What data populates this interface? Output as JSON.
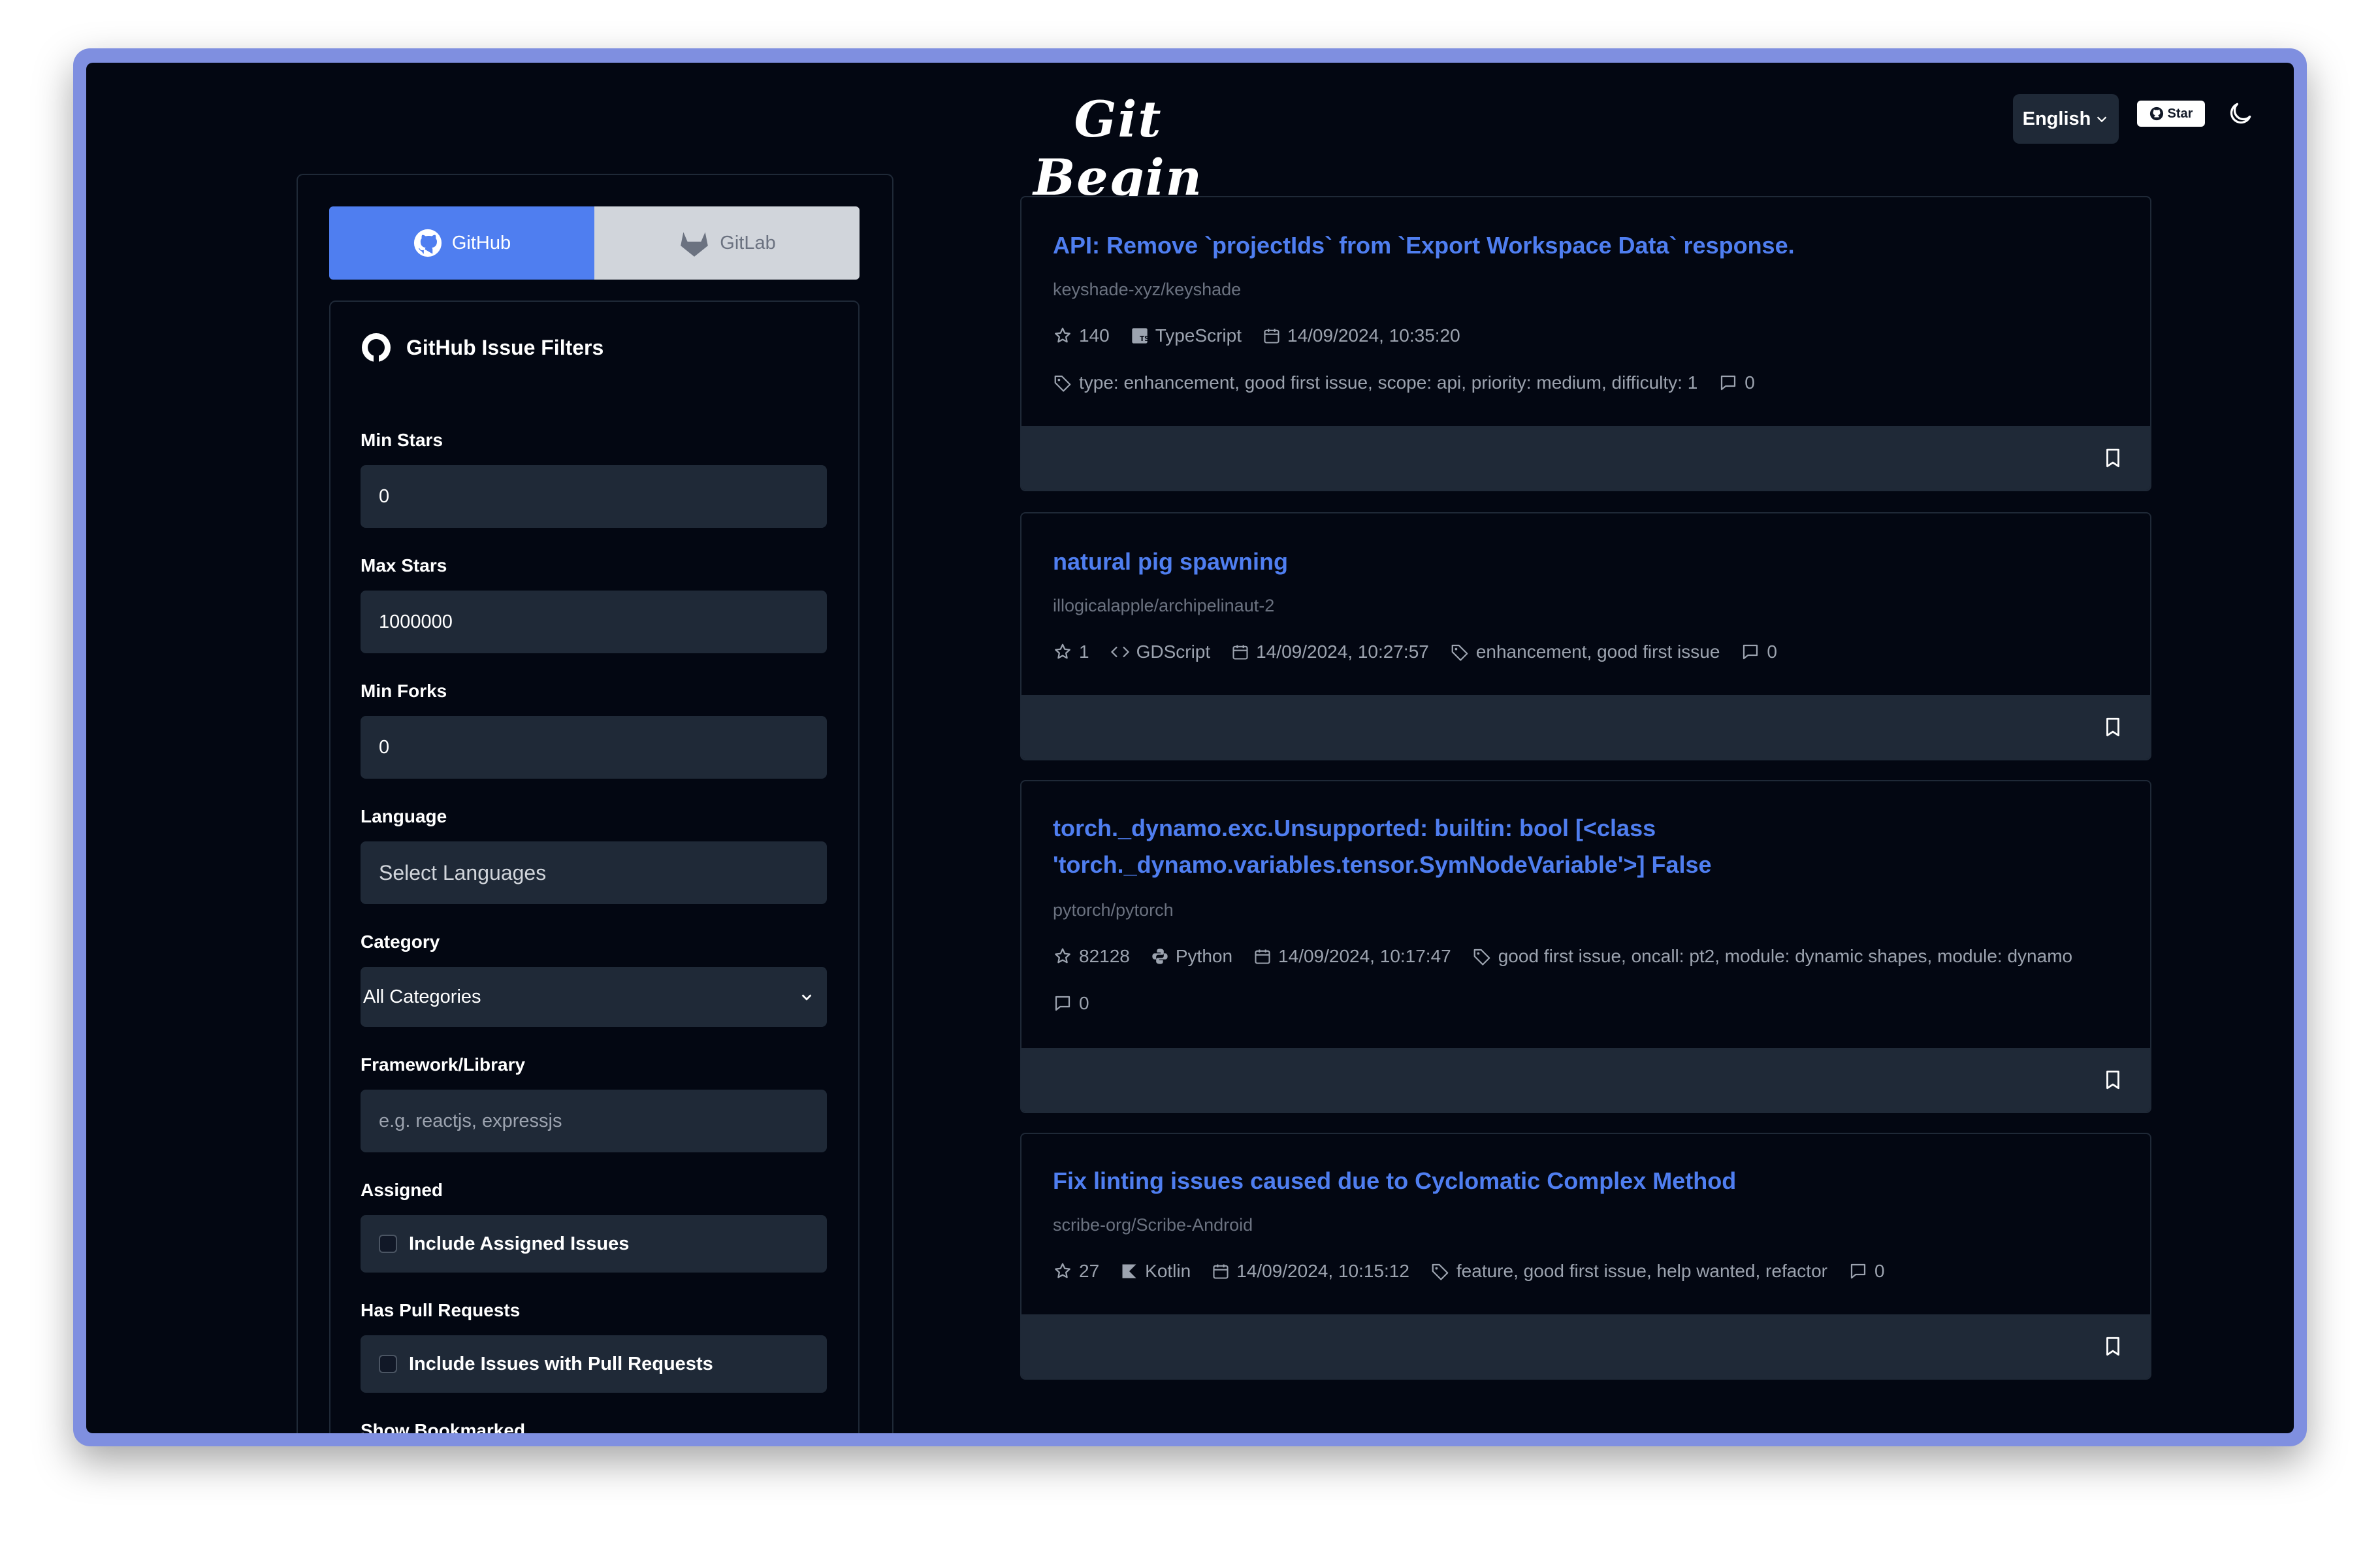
{
  "header": {
    "logo_text": "Git Begin",
    "language_label": "English",
    "star_label": "Star"
  },
  "tabs": [
    {
      "label": "GitHub",
      "icon": "github-icon",
      "active": true
    },
    {
      "label": "GitLab",
      "icon": "gitlab-icon",
      "active": false
    }
  ],
  "filters": {
    "title": "GitHub Issue Filters",
    "min_stars_label": "Min Stars",
    "min_stars_value": "0",
    "max_stars_label": "Max Stars",
    "max_stars_value": "1000000",
    "min_forks_label": "Min Forks",
    "min_forks_value": "0",
    "language_label": "Language",
    "language_placeholder": "Select Languages",
    "category_label": "Category",
    "category_value": "All Categories",
    "framework_label": "Framework/Library",
    "framework_placeholder": "e.g. reactjs, expressjs",
    "assigned_label": "Assigned",
    "assigned_checkbox": "Include Assigned Issues",
    "pr_label": "Has Pull Requests",
    "pr_checkbox": "Include Issues with Pull Requests",
    "bookmarked_label": "Show Bookmarked"
  },
  "issues": [
    {
      "title": "API: Remove `projectIds` from `Export Workspace Data` response.",
      "repo": "keyshade-xyz/keyshade",
      "stars": "140",
      "language": "TypeScript",
      "date": "14/09/2024, 10:35:20",
      "labels": "type: enhancement, good first issue, scope: api, priority: medium, difficulty: 1",
      "comments": "0"
    },
    {
      "title": "natural pig spawning",
      "repo": "illogicalapple/archipelinaut-2",
      "stars": "1",
      "language": "GDScript",
      "date": "14/09/2024, 10:27:57",
      "labels": "enhancement, good first issue",
      "comments": "0"
    },
    {
      "title_line1": "torch._dynamo.exc.Unsupported: builtin: bool [<class",
      "title_line2": "'torch._dynamo.variables.tensor.SymNodeVariable'>] False",
      "repo": "pytorch/pytorch",
      "stars": "82128",
      "language": "Python",
      "date": "14/09/2024, 10:17:47",
      "labels": "good first issue, oncall: pt2, module: dynamic shapes, module: dynamo",
      "comments": "0"
    },
    {
      "title": "Fix linting issues caused due to Cyclomatic Complex Method",
      "repo": "scribe-org/Scribe-Android",
      "stars": "27",
      "language": "Kotlin",
      "date": "14/09/2024, 10:15:12",
      "labels": "feature, good first issue, help wanted, refactor",
      "comments": "0"
    }
  ],
  "colors": {
    "accent": "#4f7ef0",
    "background": "#030712",
    "panel": "#1f2937"
  }
}
